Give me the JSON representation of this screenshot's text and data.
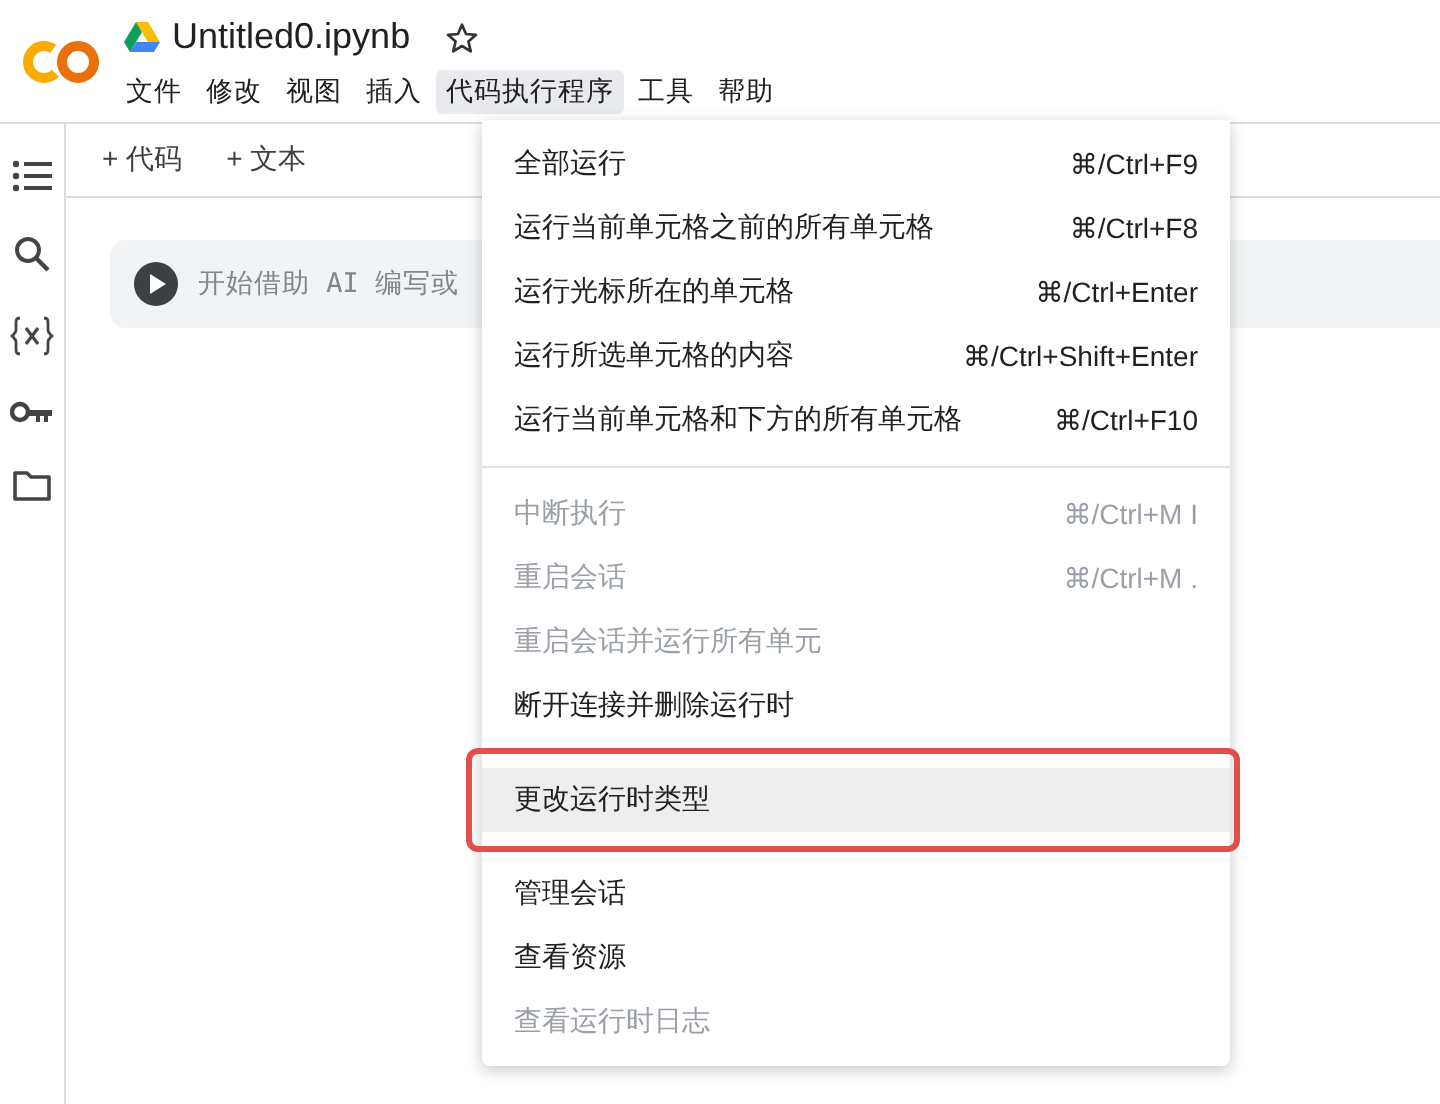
{
  "header": {
    "title": "Untitled0.ipynb",
    "starred": false
  },
  "menubar": [
    {
      "label": "文件",
      "selected": false
    },
    {
      "label": "修改",
      "selected": false
    },
    {
      "label": "视图",
      "selected": false
    },
    {
      "label": "插入",
      "selected": false
    },
    {
      "label": "代码执行程序",
      "selected": true
    },
    {
      "label": "工具",
      "selected": false
    },
    {
      "label": "帮助",
      "selected": false
    }
  ],
  "toolbar": [
    {
      "label": "+ 代码"
    },
    {
      "label": "+ 文本"
    }
  ],
  "sidebar": [
    {
      "kind": "toc"
    },
    {
      "kind": "search"
    },
    {
      "kind": "variables"
    },
    {
      "kind": "secrets"
    },
    {
      "kind": "files"
    }
  ],
  "cell": {
    "placeholder": "开始借助 AI 编写或"
  },
  "menu": {
    "groups": [
      [
        {
          "label": "全部运行",
          "shortcut": "⌘/Ctrl+F9",
          "disabled": false,
          "selected": false,
          "outlined": false
        },
        {
          "label": "运行当前单元格之前的所有单元格",
          "shortcut": "⌘/Ctrl+F8",
          "disabled": false,
          "selected": false,
          "outlined": false
        },
        {
          "label": "运行光标所在的单元格",
          "shortcut": "⌘/Ctrl+Enter",
          "disabled": false,
          "selected": false,
          "outlined": false
        },
        {
          "label": "运行所选单元格的内容",
          "shortcut": "⌘/Ctrl+Shift+Enter",
          "disabled": false,
          "selected": false,
          "outlined": false
        },
        {
          "label": "运行当前单元格和下方的所有单元格",
          "shortcut": "⌘/Ctrl+F10",
          "disabled": false,
          "selected": false,
          "outlined": false
        }
      ],
      [
        {
          "label": "中断执行",
          "shortcut": "⌘/Ctrl+M I",
          "disabled": true,
          "selected": false,
          "outlined": false
        },
        {
          "label": "重启会话",
          "shortcut": "⌘/Ctrl+M .",
          "disabled": true,
          "selected": false,
          "outlined": false
        },
        {
          "label": "重启会话并运行所有单元",
          "disabled": true,
          "selected": false,
          "outlined": false
        },
        {
          "label": "断开连接并删除运行时",
          "disabled": false,
          "selected": false,
          "outlined": false
        }
      ],
      [
        {
          "label": "更改运行时类型",
          "disabled": false,
          "selected": true,
          "outlined": true
        }
      ],
      [
        {
          "label": "管理会话",
          "disabled": false,
          "selected": false,
          "outlined": false
        },
        {
          "label": "查看资源",
          "disabled": false,
          "selected": false,
          "outlined": false
        },
        {
          "label": "查看运行时日志",
          "disabled": true,
          "selected": false,
          "outlined": false
        }
      ]
    ]
  }
}
